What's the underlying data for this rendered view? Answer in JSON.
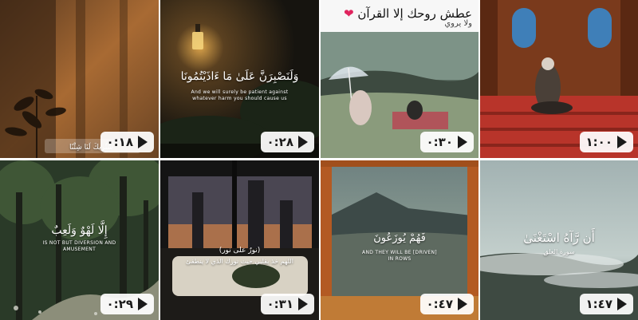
{
  "tiles": [
    {
      "duration": "٠:١٨",
      "caption_ar": "سَتُرِيكَ لَنَا شِئْنًا"
    },
    {
      "duration": "٠:٢٨",
      "caption_ar": "وَلَنَصْبِرَنَّ عَلَىٰ مَا ءَاذَيْتُمُونَا",
      "caption_en": "And we will surely be patient against whatever harm you should cause us"
    },
    {
      "duration": "٠:٣٠",
      "header_text": "عطش روحك إلا القرآن",
      "header_dots": "ولا يروي"
    },
    {
      "duration": "١:٠٠"
    },
    {
      "duration": "٠:٢٩",
      "caption_ar": "إِلَّا لَهْوٌ وَلَعِبٌ",
      "caption_en": "IS NOT BUT DIVERSION AND AMUSEMENT"
    },
    {
      "duration": "٠:٣١",
      "caption_ar": "(نورٌ على نور)",
      "caption_sub": "اللهم خذ بقلبي حيث نورك الذي لا ينطفئ"
    },
    {
      "duration": "٠:٤٧",
      "caption_ar": "فَهُمْ يُوزَعُونَ",
      "caption_en": "AND THEY WILL BE [DRIVEN] IN ROWS"
    },
    {
      "duration": "١:٤٧",
      "caption_ar": "أَن رَّآهُ اسْتَغْنَىٰ",
      "caption_sub": "سورة العلق"
    }
  ],
  "icons": {
    "play": "play-icon",
    "heart": "heart-icon"
  },
  "colors": {
    "pill_bg": "#ffffff",
    "heart": "#e0245e"
  }
}
